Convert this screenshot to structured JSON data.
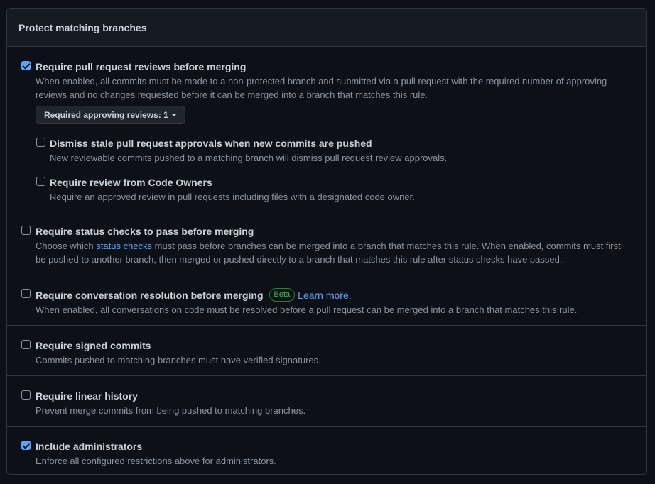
{
  "header": {
    "title": "Protect matching branches"
  },
  "rules": {
    "pr_reviews": {
      "checked": true,
      "title": "Require pull request reviews before merging",
      "desc": "When enabled, all commits must be made to a non-protected branch and submitted via a pull request with the required number of approving reviews and no changes requested before it can be merged into a branch that matches this rule.",
      "approving_label": "Required approving reviews:",
      "approving_value": "1",
      "dismiss_stale": {
        "checked": false,
        "title": "Dismiss stale pull request approvals when new commits are pushed",
        "desc": "New reviewable commits pushed to a matching branch will dismiss pull request review approvals."
      },
      "code_owners": {
        "checked": false,
        "title": "Require review from Code Owners",
        "desc": "Require an approved review in pull requests including files with a designated code owner."
      }
    },
    "status_checks": {
      "checked": false,
      "title": "Require status checks to pass before merging",
      "desc_before": "Choose which ",
      "desc_link": "status checks",
      "desc_after": " must pass before branches can be merged into a branch that matches this rule. When enabled, commits must first be pushed to another branch, then merged or pushed directly to a branch that matches this rule after status checks have passed."
    },
    "conversation": {
      "checked": false,
      "title": "Require conversation resolution before merging",
      "badge": "Beta",
      "learn_more": "Learn more",
      "learn_dot": ".",
      "desc": "When enabled, all conversations on code must be resolved before a pull request can be merged into a branch that matches this rule."
    },
    "signed": {
      "checked": false,
      "title": "Require signed commits",
      "desc": "Commits pushed to matching branches must have verified signatures."
    },
    "linear": {
      "checked": false,
      "title": "Require linear history",
      "desc": "Prevent merge commits from being pushed to matching branches."
    },
    "admins": {
      "checked": true,
      "title": "Include administrators",
      "desc": "Enforce all configured restrictions above for administrators."
    }
  },
  "colors": {
    "background": "#0d1117",
    "header_bg": "#161b22",
    "border": "#30363d",
    "accent": "#58a6ff",
    "badge": "#3fb950"
  }
}
